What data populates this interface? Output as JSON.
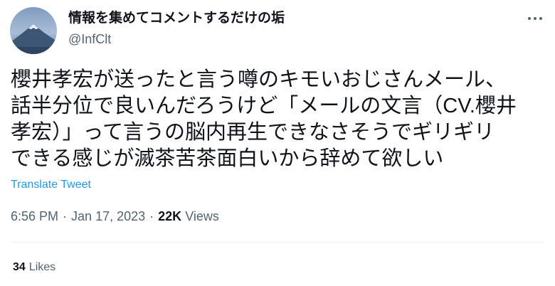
{
  "author": {
    "display_name": "情報を集めてコメントするだけの垢",
    "handle": "@InfClt"
  },
  "tweet": {
    "lines": [
      "櫻井孝宏が送ったと言う噂のキモいおじさんメール、",
      "話半分位で良いんだろうけど「メールの文言（CV.櫻井",
      "孝宏）」って言うの脳内再生できなさそうでギリギリ",
      "できる感じが滅茶苦茶面白いから辞めて欲しい"
    ],
    "translate_label": "Translate Tweet"
  },
  "meta": {
    "time": "6:56 PM",
    "separator": "·",
    "date": "Jan 17, 2023",
    "views_count": "22K",
    "views_label": "Views"
  },
  "stats": {
    "likes_count": "34",
    "likes_label": "Likes"
  },
  "icons": {
    "more": "more-horizontal-icon"
  },
  "colors": {
    "text": "#0f1419",
    "secondary": "#536471",
    "link": "#1d9bf0",
    "divider": "#eff3f4"
  }
}
